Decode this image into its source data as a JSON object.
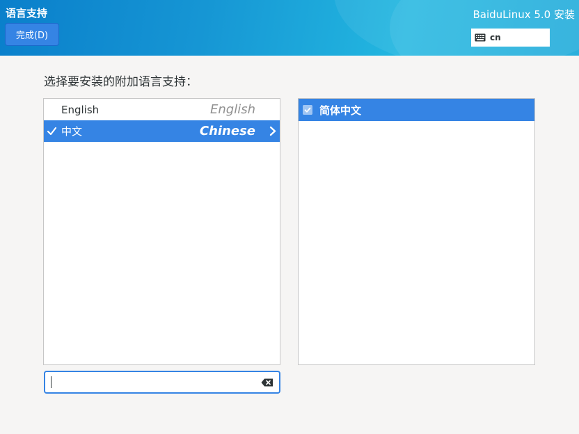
{
  "header": {
    "page_title": "语言支持",
    "done_button": "完成(D)",
    "product_title": "BaiduLinux 5.0 安装",
    "keyboard_layout": "cn",
    "keyboard_icon": "keyboard-icon"
  },
  "main": {
    "prompt": "选择要安装的附加语言支持：",
    "languages": [
      {
        "native": "English",
        "english": "English",
        "selected": false
      },
      {
        "native": "中文",
        "english": "Chinese",
        "selected": true,
        "check_icon": "checkmark-icon",
        "chevron_icon": "chevron-right-icon"
      }
    ],
    "locales": [
      {
        "label": "简体中文",
        "checked": true,
        "icon": "checkbox-checked-icon"
      }
    ],
    "search": {
      "value": "",
      "placeholder": "",
      "clear_icon": "clear-backspace-icon"
    }
  },
  "colors": {
    "accent": "#3584e4",
    "header_start": "#0a7fcb",
    "header_end": "#23b7e0",
    "background": "#f6f5f4"
  }
}
